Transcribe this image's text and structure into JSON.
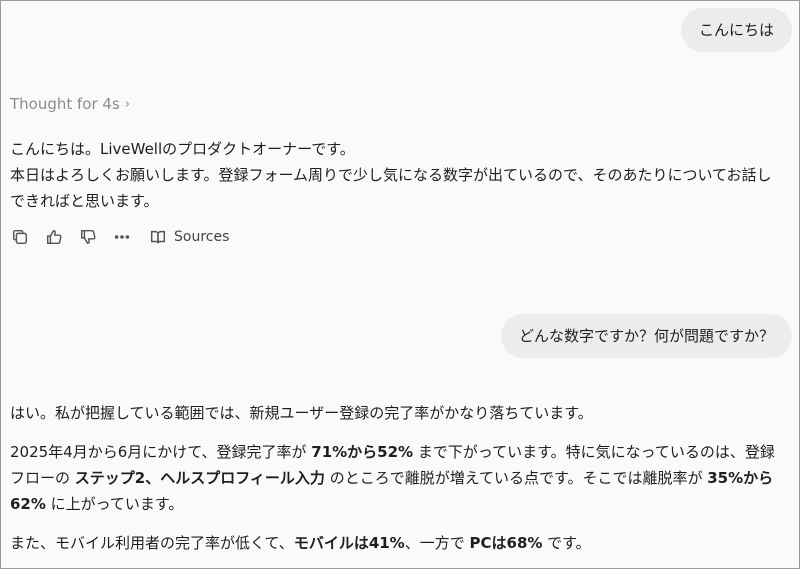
{
  "messages": {
    "user_1": "こんにちは",
    "thought_label": "Thought for 4s",
    "assistant_1_line1": "こんにちは。LiveWellのプロダクトオーナーです。",
    "assistant_1_line2": "本日はよろしくお願いします。登録フォーム周りで少し気になる数字が出ているので、そのあたりについてお話し",
    "assistant_1_line3": "できればと思います。",
    "actions": {
      "copy_icon": "copy-icon",
      "thumbs_up_icon": "thumbs-up-icon",
      "thumbs_down_icon": "thumbs-down-icon",
      "more_icon": "more-icon",
      "sources_label": "Sources"
    },
    "user_2": "どんな数字ですか？何が問題ですか？",
    "assistant_2": {
      "p1": "はい。私が把握している範囲では、新規ユーザー登録の完了率がかなり落ちています。",
      "p2_a": "2025年4月から6月にかけて、登録完了率が ",
      "p2_b": "71%から52%",
      "p2_c": " まで下がっています。特に気になっているのは、登録",
      "p2_d": "フローの ",
      "p2_e": "ステップ2、ヘルスプロフィール入力",
      "p2_f": " のところで離脱が増えている点です。そこでは離脱率が ",
      "p2_g": "35%から",
      "p2_h": "62%",
      "p2_i": " に上がっています。",
      "p3_a": "また、モバイル利用者の完了率が低くて、",
      "p3_b": "モバイルは41%",
      "p3_c": "、一方で ",
      "p3_d": "PCは68%",
      "p3_e": " です。"
    }
  }
}
